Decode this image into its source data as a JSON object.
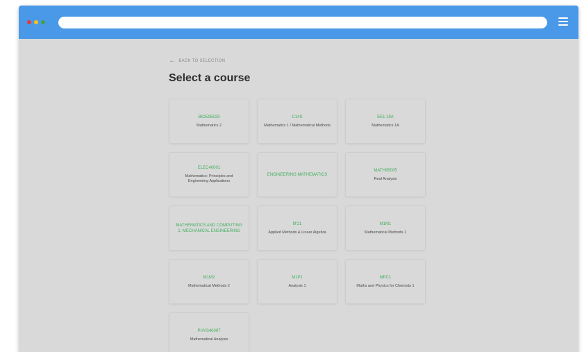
{
  "window": {
    "dots": [
      "#e53935",
      "#f5c518",
      "#43a047"
    ],
    "titlebar_color": "#4a98e8",
    "menu_icon": "hamburger-menu-icon"
  },
  "page": {
    "back_link": "BACK TO SELECTION",
    "back_icon": "arrow-left-icon",
    "title": "Select a course"
  },
  "courses": [
    {
      "code": "BIOE95029",
      "name": "Mathematics 2"
    },
    {
      "code": "C14S",
      "name": "Mathematics 1 / Mathematical Methods"
    },
    {
      "code": "EE1 19A",
      "name": "Mathematics 1A"
    },
    {
      "code": "ELEC40001",
      "name": "Mathematics: Principles and Engineering Applications"
    },
    {
      "code": "ENGINEERING MATHEMATICS",
      "name": ""
    },
    {
      "code": "MATH95005",
      "name": "Real Analysis"
    },
    {
      "code": "MATHEMATICS AND COMPUTING 1, MECHANICAL ENGINEERING",
      "name": ""
    },
    {
      "code": "M'21",
      "name": "Applied Methods & Linear Algebra"
    },
    {
      "code": "M1M1",
      "name": "Mathematical Methods 1"
    },
    {
      "code": "M1M2",
      "name": "Mathematical Methods 2"
    },
    {
      "code": "M1P1",
      "name": "Analysis 1"
    },
    {
      "code": "MPC1",
      "name": "Maths and Physics for Chemists 1"
    },
    {
      "code": "PHYS40007",
      "name": "Mathematical Analysis"
    }
  ]
}
